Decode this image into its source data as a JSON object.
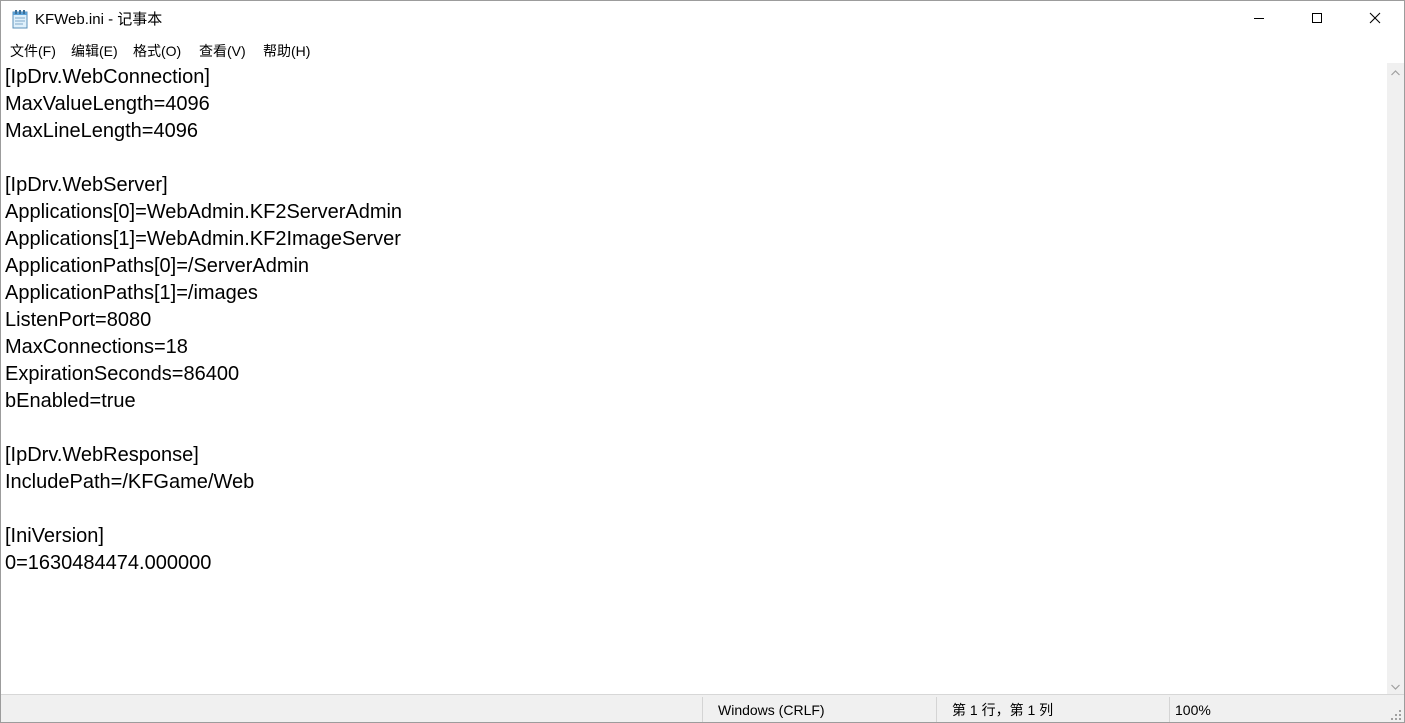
{
  "window": {
    "title": "KFWeb.ini - 记事本",
    "icon": "notepad-icon",
    "controls": [
      "minimize-icon",
      "maximize-icon",
      "close-icon"
    ]
  },
  "menu": {
    "items": [
      {
        "label": "文件(F)"
      },
      {
        "label": "编辑(E)"
      },
      {
        "label": "格式(O)"
      },
      {
        "label": "查看(V)"
      },
      {
        "label": "帮助(H)"
      }
    ]
  },
  "editor": {
    "lines": [
      "[IpDrv.WebConnection]",
      "MaxValueLength=4096",
      "MaxLineLength=4096",
      "",
      "[IpDrv.WebServer]",
      "Applications[0]=WebAdmin.KF2ServerAdmin",
      "Applications[1]=WebAdmin.KF2ImageServer",
      "ApplicationPaths[0]=/ServerAdmin",
      "ApplicationPaths[1]=/images",
      "ListenPort=8080",
      "MaxConnections=18",
      "ExpirationSeconds=86400",
      "bEnabled=true",
      "",
      "[IpDrv.WebResponse]",
      "IncludePath=/KFGame/Web",
      "",
      "[IniVersion]",
      "0=1630484474.000000"
    ]
  },
  "status": {
    "line_ending": "Windows (CRLF)",
    "position": "第 1 行，第 1 列",
    "zoom": "100%"
  },
  "colors": {
    "background": "#ffffff",
    "statusbar": "#f0f0f0",
    "text": "#000000"
  }
}
